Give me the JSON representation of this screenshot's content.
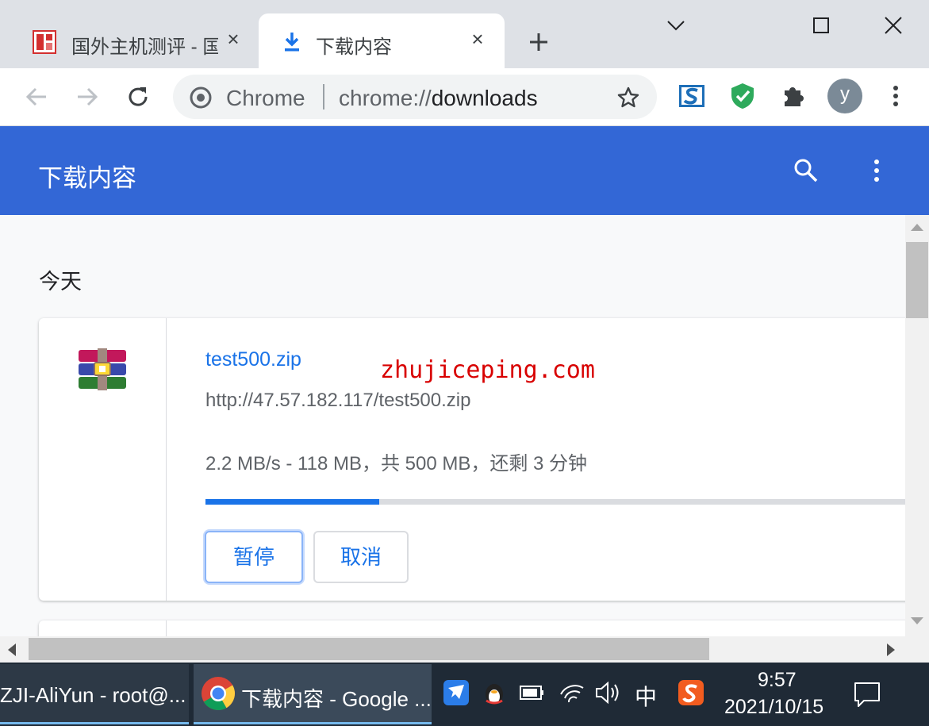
{
  "tabs": [
    {
      "title": "国外主机测评 - 国",
      "icon": "site-favicon",
      "active": false
    },
    {
      "title": "下载内容",
      "icon": "download-icon",
      "active": true
    }
  ],
  "omnibox": {
    "site_label": "Chrome",
    "url_scheme": "chrome://",
    "url_path": "downloads"
  },
  "profile": {
    "initial": "y"
  },
  "header": {
    "title": "下载内容"
  },
  "downloads": {
    "section_label": "今天",
    "items": [
      {
        "file_name": "test500.zip",
        "url": "http://47.57.182.117/test500.zip",
        "status": "2.2 MB/s - 118 MB，共 500 MB，还剩 3 分钟",
        "progress_fraction": 0.236,
        "buttons": {
          "pause": "暂停",
          "cancel": "取消"
        }
      }
    ]
  },
  "watermark": "zhujiceping.com",
  "taskbar": {
    "items": [
      {
        "label": "ZJI-AliYun - root@..."
      },
      {
        "label": "下载内容 - Google ..."
      }
    ],
    "ime": "中",
    "clock_time": "9:57",
    "clock_date": "2021/10/15"
  },
  "colors": {
    "header_blue": "#3367d6",
    "link_blue": "#1a73e8",
    "watermark_red": "#d80000"
  }
}
